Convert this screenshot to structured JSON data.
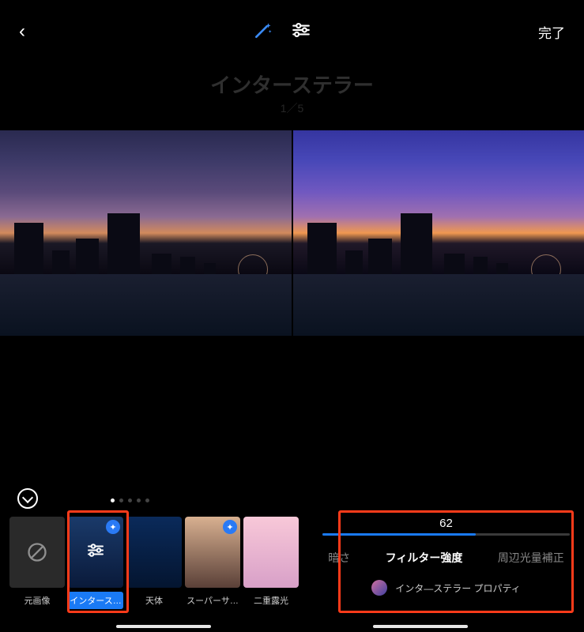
{
  "header": {
    "done_label": "完了"
  },
  "title": {
    "main": "インターステラー",
    "sub": "1／5"
  },
  "filters": {
    "items": [
      {
        "label": "元画像"
      },
      {
        "label": "インタース…"
      },
      {
        "label": "天体"
      },
      {
        "label": "スーパーサ…"
      },
      {
        "label": "二重露光"
      }
    ]
  },
  "adjust": {
    "value": "62",
    "fill_percent": 62,
    "tabs": {
      "darkness": "暗さ",
      "strength": "フィルター強度",
      "vignette": "周辺光量補正"
    },
    "properties_label": "インタ―ステラー プロパティ"
  }
}
